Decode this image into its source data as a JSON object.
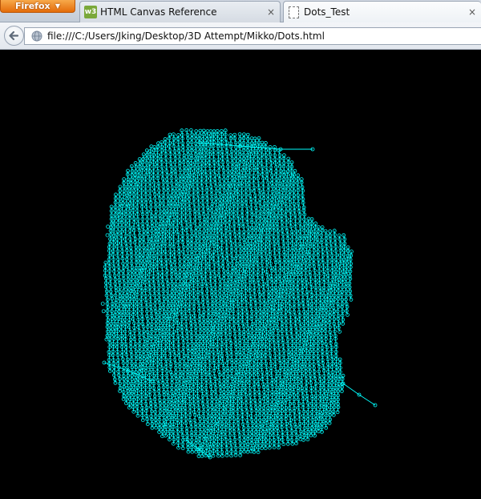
{
  "browser": {
    "menu_button_label": "Firefox",
    "tabs": [
      {
        "title": "HTML Canvas Reference",
        "favicon": "w3-icon",
        "favicon_text": "w3",
        "close": "×",
        "active": false
      },
      {
        "title": "Dots_Test",
        "favicon": "blank-page-icon",
        "close": "×",
        "active": true
      }
    ],
    "url": "file:///C:/Users/Jking/Desktop/3D Attempt/Mikko/Dots.html"
  },
  "colors": {
    "firefox_button": "#e46c0a",
    "canvas_background": "#000000",
    "dot_color": "#00ffff"
  },
  "icons": {
    "back": "back-arrow-icon",
    "globe": "globe-icon",
    "menu": "chevron-down-icon"
  }
}
